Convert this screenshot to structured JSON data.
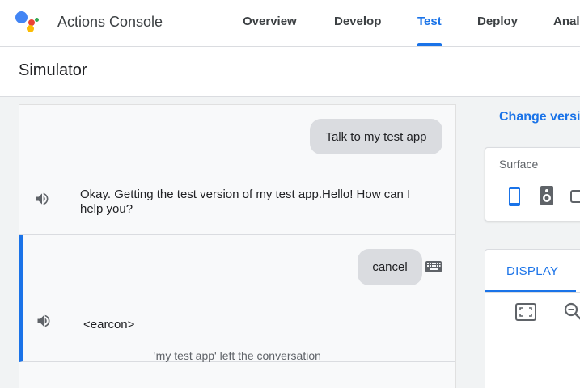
{
  "header": {
    "app_title": "Actions Console",
    "tabs": [
      {
        "label": "Overview"
      },
      {
        "label": "Develop"
      },
      {
        "label": "Test",
        "active": true
      },
      {
        "label": "Deploy"
      },
      {
        "label": "Analytics"
      }
    ]
  },
  "subheader": {
    "title": "Simulator"
  },
  "conversation": {
    "turns": [
      {
        "user": "Talk to my test app",
        "response": "Okay. Getting the test version of my test app.Hello! How can I help you?"
      },
      {
        "user": "cancel",
        "response": "<earcon>",
        "status": "'my test app' left the conversation"
      }
    ]
  },
  "right_panel": {
    "change_version": "Change version",
    "surface_label": "Surface",
    "surface_icons": [
      "phone-icon",
      "speaker-icon",
      "display-icon"
    ],
    "display_tab": "DISPLAY"
  },
  "colors": {
    "accent": "#1a73e8",
    "bubble": "#dadce0"
  }
}
